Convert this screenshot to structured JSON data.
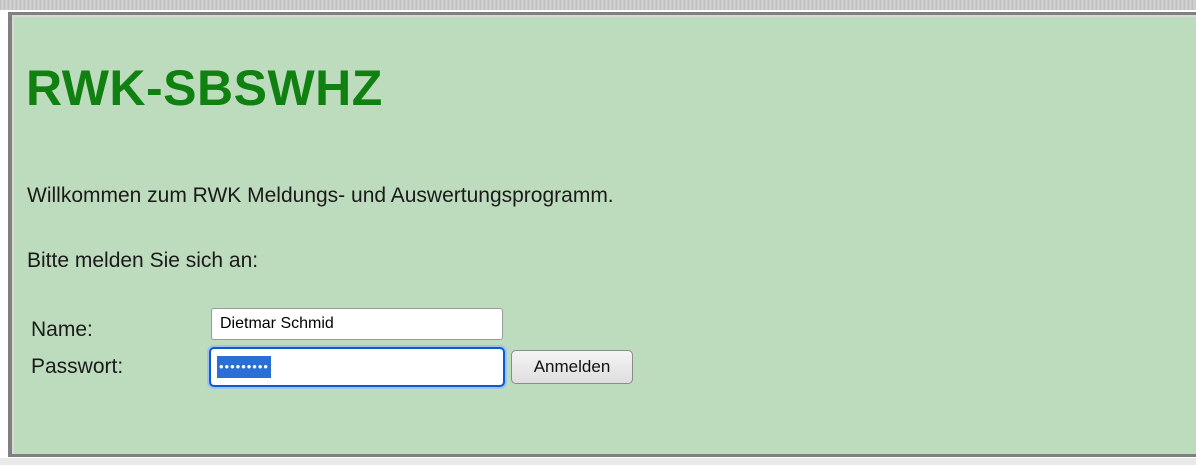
{
  "page": {
    "title": "RWK-SBSWHZ",
    "welcome_text": "Willkommen zum RWK Meldungs- und Auswertungsprogramm.",
    "login_prompt": "Bitte melden Sie sich an:"
  },
  "login_form": {
    "name_label": "Name:",
    "name_value": "Dietmar Schmid",
    "password_label": "Passwort:",
    "password_masked": "•••••••••",
    "submit_label": "Anmelden"
  },
  "colors": {
    "panel_background": "#bddcbd",
    "title_green": "#108010",
    "focus_blue": "#0a5bd1"
  }
}
